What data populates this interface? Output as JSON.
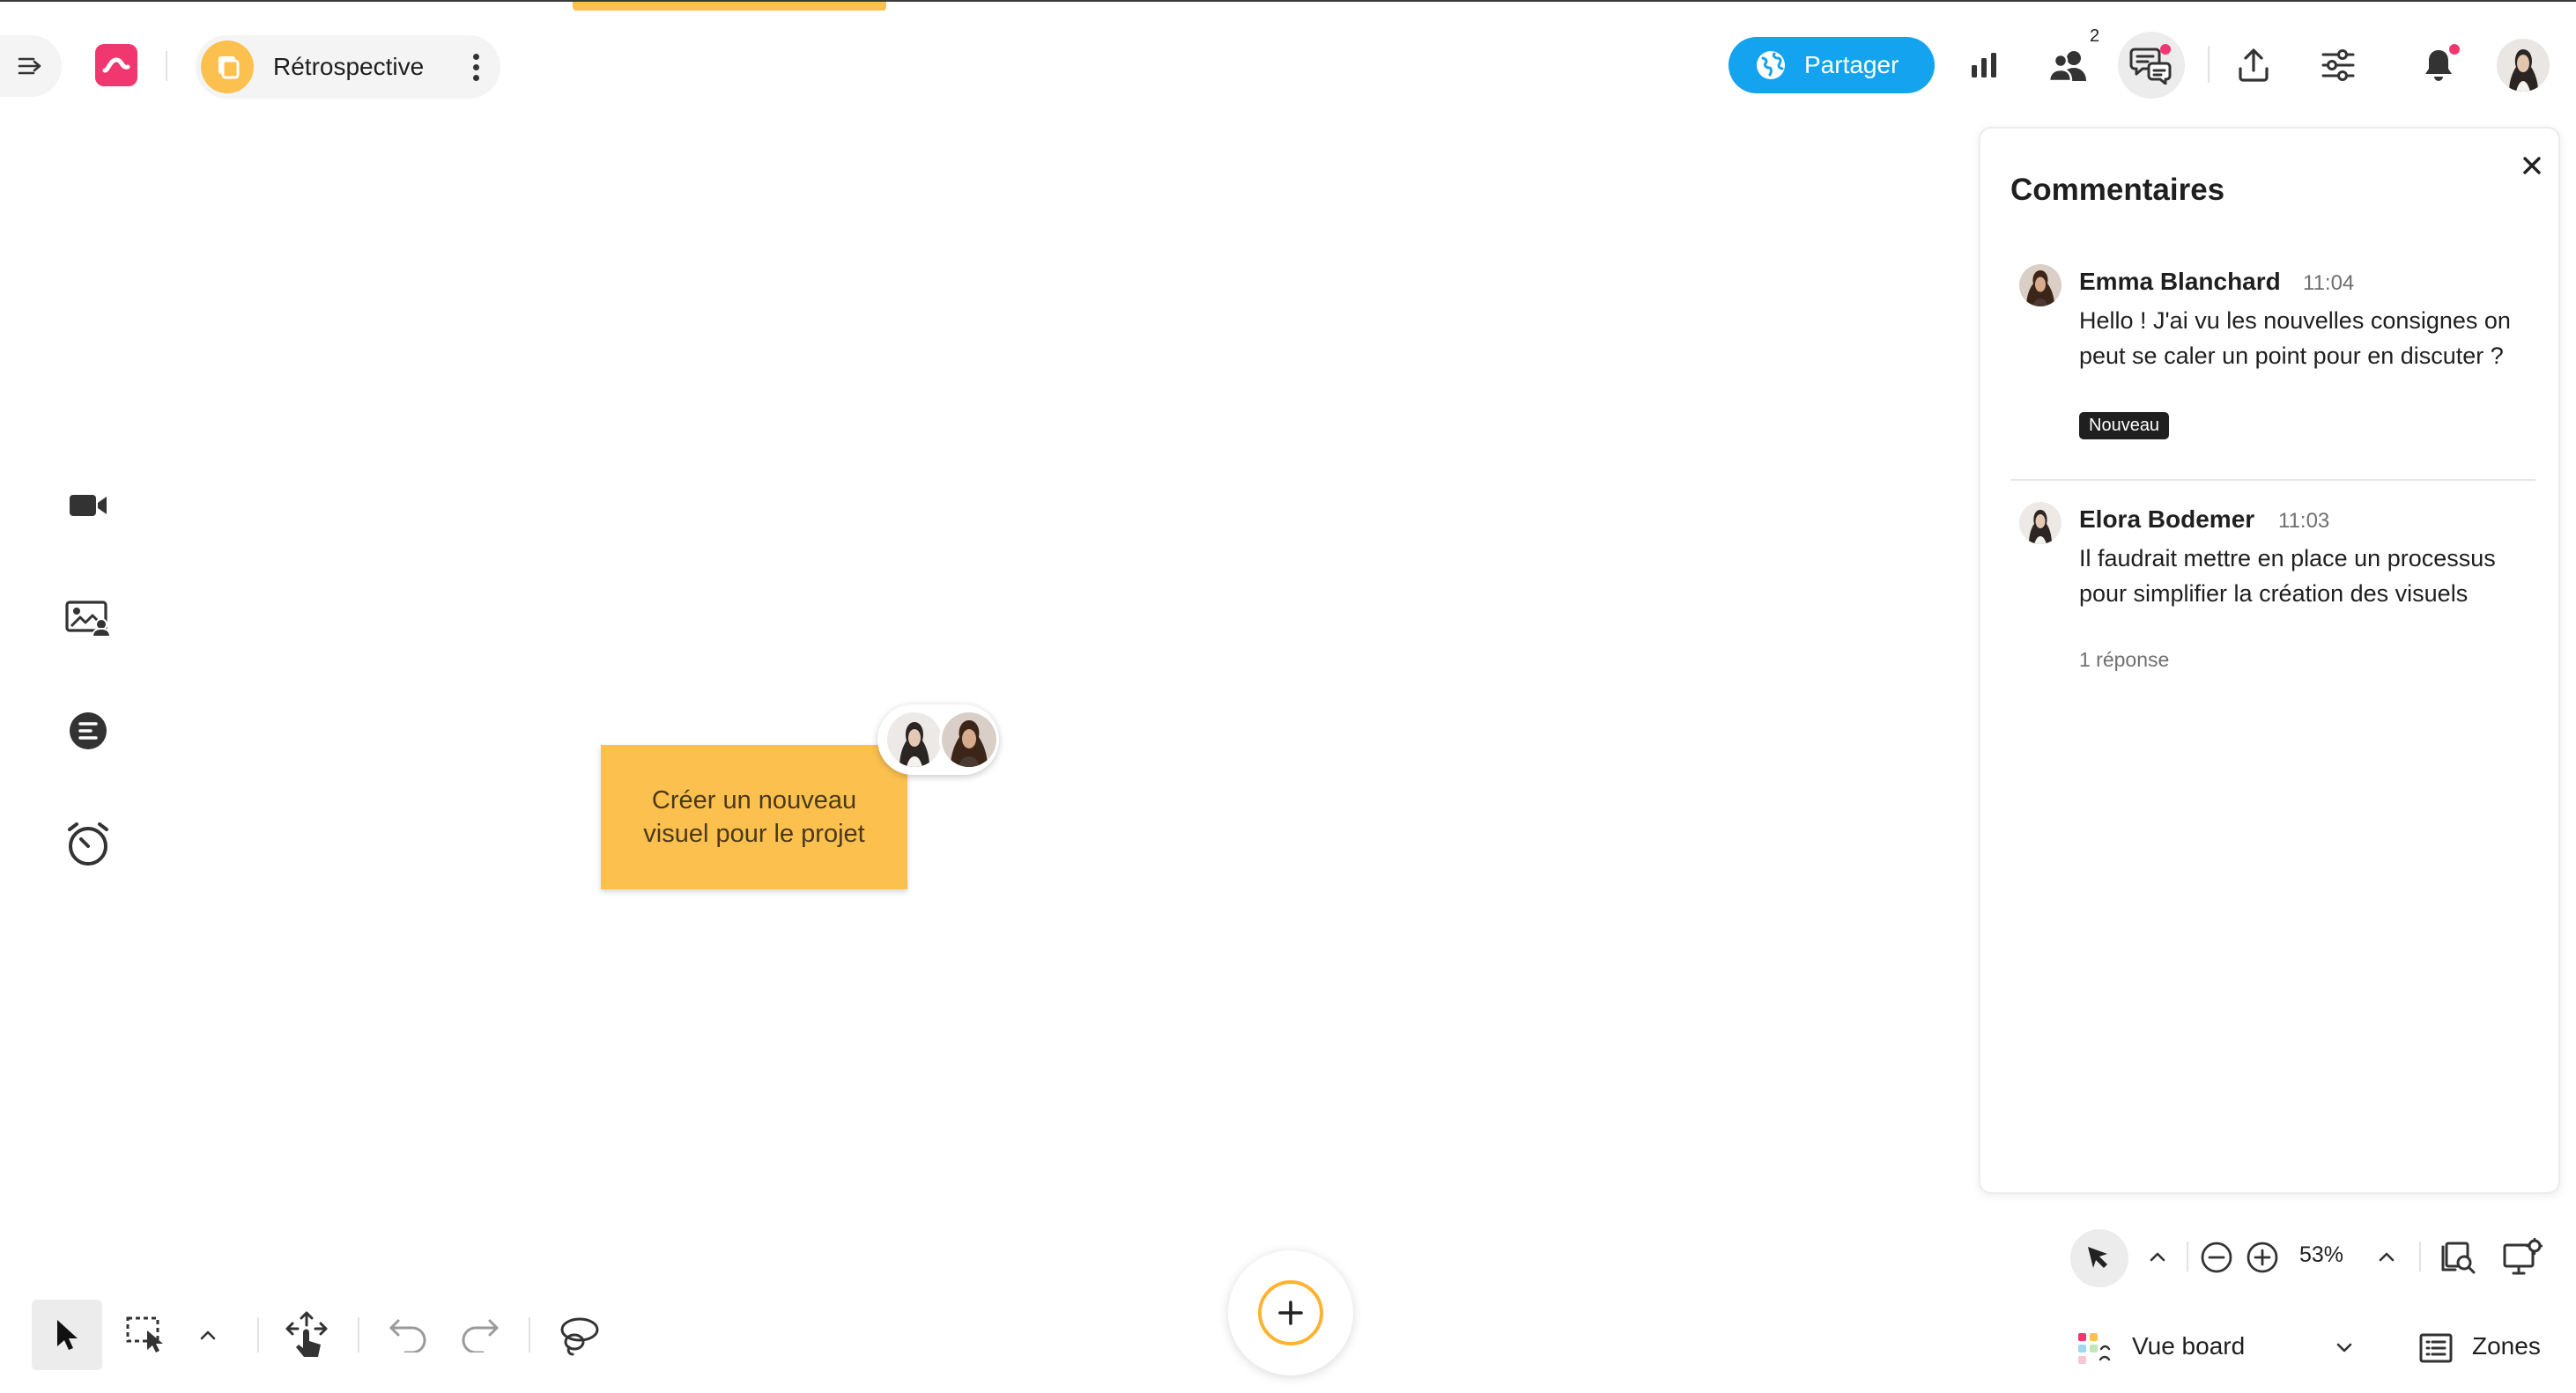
{
  "board": {
    "title": "Rétrospective"
  },
  "toolbar": {
    "share_label": "Partager",
    "collaborators_count": "2"
  },
  "sticky": {
    "text": "Créer un nouveau visuel pour le projet"
  },
  "comments_panel": {
    "title": "Commentaires",
    "comments": [
      {
        "author": "Emma Blanchard",
        "time": "11:04",
        "text": "Hello ! J'ai vu les nouvelles consignes on peut se caler un point pour en discuter ?",
        "tag": "Nouveau"
      },
      {
        "author": "Elora Bodemer",
        "time": "11:03",
        "text": "Il faudrait mettre en place un processus pour simplifier la création des visuels",
        "replies": "1 réponse"
      }
    ]
  },
  "bottom_right": {
    "zoom": "53%",
    "view_label": "Vue board",
    "zones_label": "Zones"
  },
  "colors": {
    "brand": "#f0376f",
    "accent": "#14a4ef",
    "sticky": "#fcc04f"
  },
  "icons": [
    "collapse-icon",
    "app-logo-icon",
    "board-icon",
    "more-icon",
    "globe-icon",
    "chart-icon",
    "collaborators-icon",
    "comments-icon",
    "upload-icon",
    "settings-icon",
    "bell-icon",
    "video-icon",
    "image-gallery-icon",
    "agenda-icon",
    "timer-icon",
    "close-icon",
    "cursor-icon",
    "chevron-up-icon",
    "zoom-out-icon",
    "zoom-in-icon",
    "search-board-icon",
    "present-icon",
    "view-board-icon",
    "chevron-down-icon",
    "zones-icon",
    "select-icon",
    "marquee-select-icon",
    "move-icon",
    "undo-icon",
    "redo-icon",
    "lasso-icon",
    "plus-icon"
  ]
}
